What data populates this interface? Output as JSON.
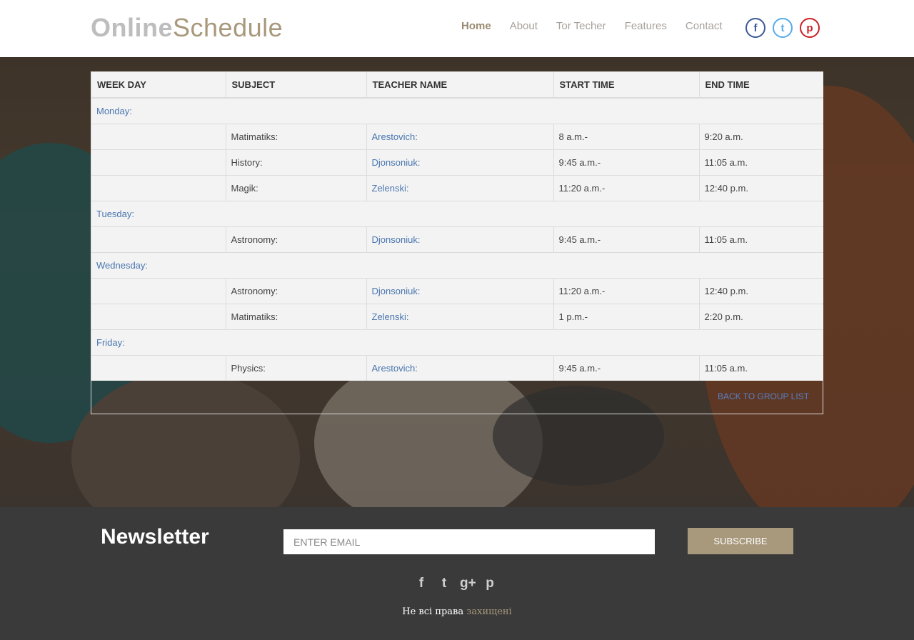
{
  "header": {
    "logo_part1": "Online",
    "logo_part2": "Schedule",
    "nav": [
      "Home",
      "About",
      "Tor Techer",
      "Features",
      "Contact"
    ],
    "social": [
      "facebook-icon",
      "twitter-icon",
      "pinterest-icon"
    ],
    "social_glyphs": [
      "f",
      "t",
      "p"
    ]
  },
  "table": {
    "headers": [
      "WEEK DAY",
      "SUBJECT",
      "TEACHER NAME",
      "START TIME",
      "END TIME"
    ],
    "days": [
      {
        "day": "Monday:",
        "lessons": [
          {
            "subject": "Matimatiks:",
            "teacher": "Arestovich:",
            "start": "8 a.m.-",
            "end": "9:20 a.m."
          },
          {
            "subject": "History:",
            "teacher": "Djonsoniuk:",
            "start": "9:45 a.m.-",
            "end": "11:05 a.m."
          },
          {
            "subject": "Magik:",
            "teacher": "Zelenski:",
            "start": "11:20 a.m.-",
            "end": "12:40 p.m."
          }
        ]
      },
      {
        "day": "Tuesday:",
        "lessons": [
          {
            "subject": "Astronomy:",
            "teacher": "Djonsoniuk:",
            "start": "9:45 a.m.-",
            "end": "11:05 a.m."
          }
        ]
      },
      {
        "day": "Wednesday:",
        "lessons": [
          {
            "subject": "Astronomy:",
            "teacher": "Djonsoniuk:",
            "start": "11:20 a.m.-",
            "end": "12:40 p.m."
          },
          {
            "subject": "Matimatiks:",
            "teacher": "Zelenski:",
            "start": "1 p.m.-",
            "end": "2:20 p.m."
          }
        ]
      },
      {
        "day": "Friday:",
        "lessons": [
          {
            "subject": "Physics:",
            "teacher": "Arestovich:",
            "start": "9:45 a.m.-",
            "end": "11:05 a.m."
          }
        ]
      }
    ],
    "back_link": "BACK TO GROUP LIST"
  },
  "footer": {
    "newsletter_title": "Newsletter",
    "email_placeholder": "ENTER EMAIL",
    "subscribe_label": "SUBSCRIBE",
    "social_glyphs": [
      "f",
      "t",
      "g+",
      "p"
    ],
    "social_names": [
      "facebook-icon",
      "twitter-icon",
      "google-plus-icon",
      "pinterest-icon"
    ],
    "copyright_text": "Не всі права",
    "copyright_highlight": "захищені"
  },
  "colors": {
    "accent": "#a8987c",
    "link": "#4a76b0",
    "footer_bg": "#3a3a3a",
    "facebook": "#3b5998",
    "twitter": "#55acee",
    "pinterest": "#cb2027"
  }
}
